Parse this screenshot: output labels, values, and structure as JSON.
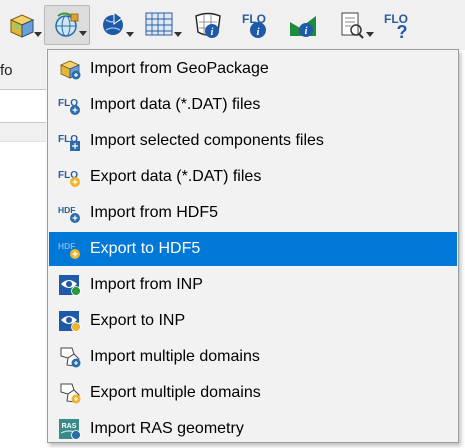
{
  "toolbar": {
    "buttons": [
      {
        "name": "geopackage-tool-button",
        "icon": "geopackage-cube-icon",
        "dropdown": true
      },
      {
        "name": "import-export-tool-button",
        "icon": "globe-gear-icon",
        "dropdown": true,
        "active": true
      },
      {
        "name": "tool-button-3",
        "icon": "globe-arrow-icon",
        "dropdown": true
      },
      {
        "name": "tool-button-4",
        "icon": "grid-info-icon",
        "dropdown": true
      },
      {
        "name": "tool-button-5",
        "icon": "grid-info-shape-icon",
        "dropdown": false
      },
      {
        "name": "tool-button-6",
        "icon": "flo-info-icon",
        "dropdown": false
      },
      {
        "name": "tool-button-7",
        "icon": "profile-info-icon",
        "dropdown": false
      },
      {
        "name": "tool-button-8",
        "icon": "document-search-icon",
        "dropdown": true
      },
      {
        "name": "tool-button-9",
        "icon": "flo-help-icon",
        "dropdown": false
      }
    ]
  },
  "left_panel": {
    "info_label": "fo"
  },
  "menu": {
    "items": [
      {
        "label": "Import from GeoPackage",
        "icon": "geopackage-icon",
        "highlighted": false
      },
      {
        "label": "Import data (*.DAT) files",
        "icon": "flo-import-icon",
        "highlighted": false
      },
      {
        "label": "Import selected components files",
        "icon": "flo-import-selected-icon",
        "highlighted": false
      },
      {
        "label": "Export data (*.DAT) files",
        "icon": "flo-export-icon",
        "highlighted": false
      },
      {
        "label": "Import from HDF5",
        "icon": "hdf5-import-icon",
        "highlighted": false
      },
      {
        "label": "Export to HDF5",
        "icon": "hdf5-export-icon",
        "highlighted": true
      },
      {
        "label": "Import from INP",
        "icon": "inp-import-icon",
        "highlighted": false
      },
      {
        "label": "Export to INP",
        "icon": "inp-export-icon",
        "highlighted": false
      },
      {
        "label": "Import multiple domains",
        "icon": "domains-import-icon",
        "highlighted": false
      },
      {
        "label": "Export multiple domains",
        "icon": "domains-export-icon",
        "highlighted": false
      },
      {
        "label": "Import RAS geometry",
        "icon": "ras-import-icon",
        "highlighted": false
      }
    ]
  },
  "colors": {
    "highlight": "#0078d7",
    "menu_bg": "#f2f2f2",
    "toolbar_bg": "#f0f0f0"
  }
}
